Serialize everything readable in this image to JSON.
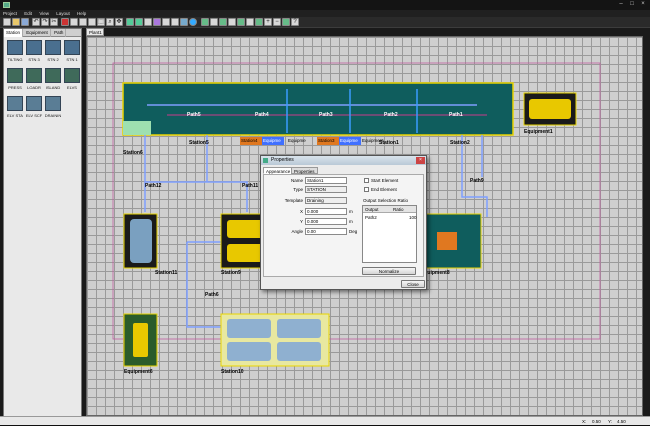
{
  "menu": [
    "Project",
    "Edit",
    "View",
    "Layout",
    "Help"
  ],
  "sidebar": {
    "tabs": [
      "Station",
      "Equipment",
      "Path"
    ],
    "items": [
      "TILTING",
      "STN 3",
      "STN 2",
      "STN 1",
      "PRESS",
      "LOADR",
      "ISLAND",
      "ELVS",
      "ELV STA",
      "ELV SCF",
      "DRAININ"
    ]
  },
  "document_tab": "Plant1",
  "labels": {
    "station6": "Station6",
    "station5": "Station5",
    "station1": "Station1",
    "station2": "Station2",
    "equipment1": "Equipment1",
    "station11": "Station11",
    "station9": "Station9",
    "station10": "Station10",
    "equipment6": "Equipment6",
    "equipment8": "Equipment8",
    "path1": "Path1",
    "path2": "Path2",
    "path3": "Path3",
    "path4": "Path4",
    "path5": "Path5",
    "path6": "Path6",
    "path9": "Path9",
    "path11": "Path11",
    "path12": "Path12",
    "tag_station4": "Station4",
    "tag_equip": "Equipme",
    "tag_equipme2": "Equipme",
    "tag_station3": "Station3",
    "tag_equip3": "Equipme",
    "tag_equip4": "Equipment"
  },
  "dialog": {
    "title": "Properties",
    "tabs": [
      "Appearance",
      "Properties"
    ],
    "name_label": "Name",
    "name_value": "Station1",
    "type_label": "Type",
    "type_value": "STATION",
    "template_label": "Template",
    "template_value": "Draining",
    "x_label": "X",
    "x_value": "0.000",
    "x_unit": "m",
    "y_label": "Y",
    "y_value": "0.000",
    "y_unit": "m",
    "angle_label": "Angle",
    "angle_value": "0.00",
    "angle_unit": "Deg",
    "start_element": "Start Element",
    "end_element": "End Element",
    "output_heading": "Output Selection Ratio",
    "col_output": "Output",
    "col_ratio": "Ratio",
    "row_output": "Path2",
    "row_ratio": "100",
    "normalize": "Normalize",
    "close": "Close"
  },
  "status": {
    "x_label": "X:",
    "x_value": "0.50",
    "y_label": "Y:",
    "y_value": "4.50"
  },
  "colors": {
    "accent_yellow": "#e8d400",
    "path_blue": "#7f9fff",
    "teal_station": "#0f5d5d",
    "boundary_pink": "#c060a0"
  }
}
